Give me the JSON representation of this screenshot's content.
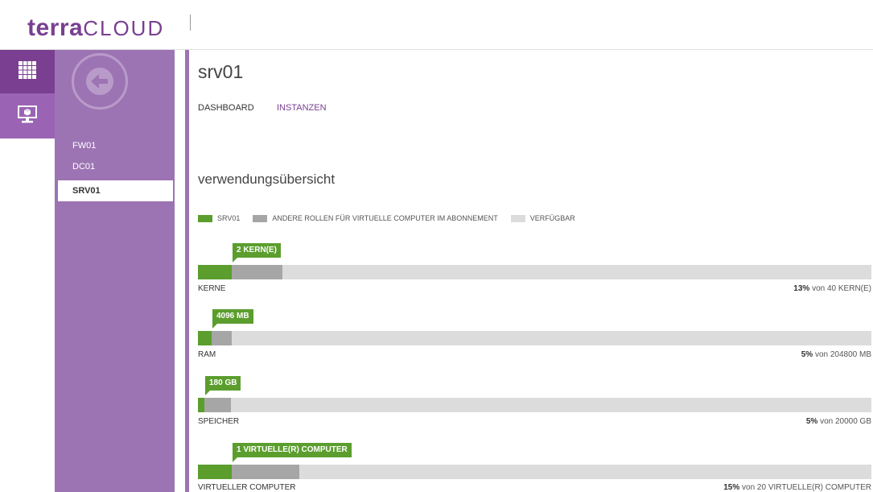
{
  "header": {
    "logo_bold": "terra",
    "logo_light": "CLOUD"
  },
  "rail": {
    "items": [
      {
        "icon": "grid-icon"
      },
      {
        "icon": "monitor-icon"
      }
    ]
  },
  "nav": {
    "items": [
      {
        "label": "FW01"
      },
      {
        "label": "DC01"
      },
      {
        "label": "SRV01"
      }
    ]
  },
  "main": {
    "title": "srv01",
    "tabs": [
      {
        "label": "DASHBOARD"
      },
      {
        "label": "INSTANZEN"
      }
    ],
    "section_title": "verwendungsübersicht",
    "legend": [
      {
        "label": "SRV01",
        "color": "#5b9e2e"
      },
      {
        "label": "ANDERE ROLLEN FÜR VIRTUELLE COMPUTER IM ABONNEMENT",
        "color": "#a6a6a6"
      },
      {
        "label": "VERFÜGBAR",
        "color": "#dcdcdc"
      }
    ],
    "metrics": [
      {
        "callout": "2 KERN(E)",
        "label": "KERNE",
        "percent": "13%",
        "total": "von 40 KERN(E)",
        "used_fraction": 0.05,
        "other_fraction": 0.075
      },
      {
        "callout": "4096 MB",
        "label": "RAM",
        "percent": "5%",
        "total": "von 204800 MB",
        "used_fraction": 0.02,
        "other_fraction": 0.03
      },
      {
        "callout": "180 GB",
        "label": "SPEICHER",
        "percent": "5%",
        "total": "von 20000 GB",
        "used_fraction": 0.009,
        "other_fraction": 0.04
      },
      {
        "callout": "1 VIRTUELLE(R) COMPUTER",
        "label": "VIRTUELLER COMPUTER",
        "percent": "15%",
        "total": "von 20 VIRTUELLE(R) COMPUTER",
        "used_fraction": 0.05,
        "other_fraction": 0.1
      }
    ]
  }
}
